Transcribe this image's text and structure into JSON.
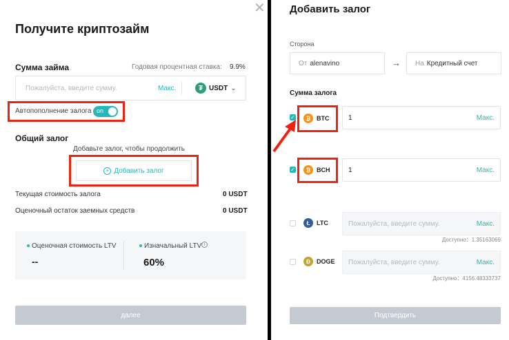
{
  "loan_panel": {
    "close_icon": "close-icon",
    "title": "Получите криптозайм",
    "loan_amount": {
      "label": "Сумма займа",
      "rate_label": "Годовая процентная ставка:",
      "rate_value": "9.9%",
      "placeholder": "Пожалуйста, введите сумму.",
      "max_label": "Макс.",
      "currency": "USDT",
      "currency_icon": "tether-icon"
    },
    "auto_topup": {
      "label": "Автопополнение залога",
      "toggle_text": "on",
      "enabled": true
    },
    "collateral": {
      "label": "Общий залог",
      "hint": "Добавьте залог, чтобы продолжить",
      "add_button": "Добавить залог"
    },
    "rows": [
      {
        "label": "Текущая стоимость залога",
        "value": "0 USDT"
      },
      {
        "label": "Оценочный остаток заемных средств",
        "value": "0 USDT"
      }
    ],
    "ltv": {
      "estimated_label": "Оценочная стоимость LTV",
      "estimated_value": "--",
      "initial_label": "Изначальный LTV",
      "initial_value": "60%",
      "info_icon": "info-icon"
    },
    "next_button": "далее"
  },
  "collateral_panel": {
    "title": "Добавить залог",
    "side_label": "Сторона",
    "from_prefix": "От",
    "from_value": "alenavino",
    "to_prefix": "На",
    "to_value": "Кредитный счет",
    "amount_label": "Сумма залога",
    "max_label": "Макс.",
    "placeholder": "Пожалуйста, введите сумму.",
    "coins": [
      {
        "symbol": "BTC",
        "checked": true,
        "amount": "1",
        "color": "#f7931a"
      },
      {
        "symbol": "BCH",
        "checked": true,
        "amount": "1",
        "color": "#f7931a"
      },
      {
        "symbol": "LTC",
        "checked": false,
        "amount": "",
        "available": "Доступно：1.35163069",
        "color": "#345d9d"
      },
      {
        "symbol": "DOGE",
        "checked": false,
        "amount": "",
        "available": "Доступно：4156.48333737",
        "color": "#c2a633"
      }
    ],
    "confirm_button": "Подтвердить"
  },
  "colors": {
    "accent": "#29b6b6",
    "highlight": "#f0220f",
    "disabled": "#c5c9d2"
  }
}
